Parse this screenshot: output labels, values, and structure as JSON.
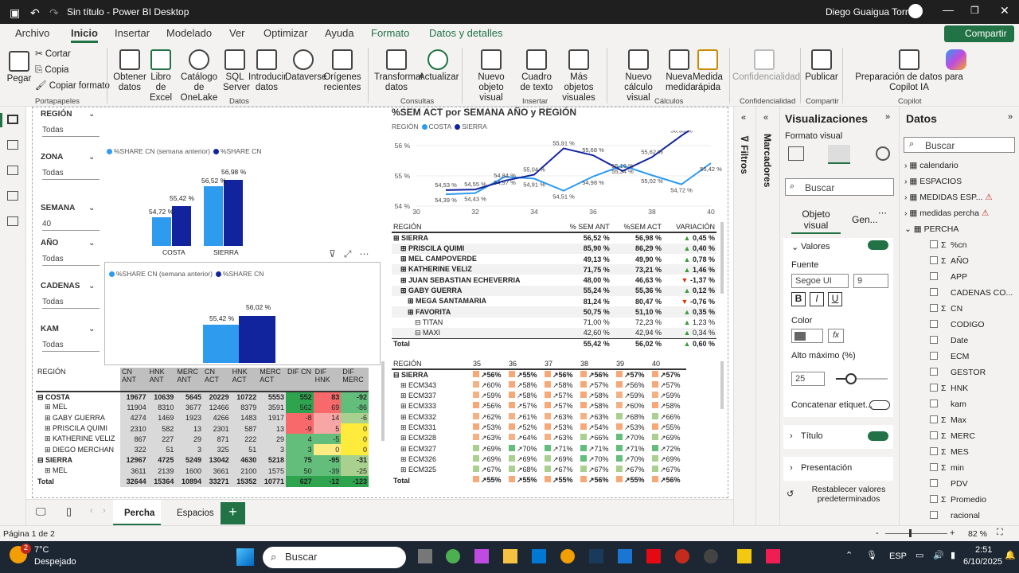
{
  "window": {
    "title": "Sin título - Power BI Desktop",
    "user": "Diego Guaigua Torres"
  },
  "menu": [
    "Archivo",
    "Inicio",
    "Insertar",
    "Modelado",
    "Ver",
    "Optimizar",
    "Ayuda",
    "Formato",
    "Datos y detalles"
  ],
  "share_button": "Compartir",
  "ribbon": {
    "buttons": [
      "Pegar",
      "Cortar",
      "Copia",
      "Copiar formato",
      "Obtener datos",
      "Libro de Excel",
      "Catálogo de OneLake",
      "SQL Server",
      "Introducir datos",
      "Dataverse",
      "Orígenes recientes",
      "Transformar datos",
      "Actualizar",
      "Nuevo objeto visual",
      "Cuadro de texto",
      "Más objetos visuales",
      "Nuevo cálculo visual",
      "Nueva medida",
      "Medida rápida",
      "Confidencialidad",
      "Publicar",
      "Preparación de datos para Copilot IA"
    ],
    "groups": [
      "Portapapeles",
      "Datos",
      "Consultas",
      "Insertar",
      "Cálculos",
      "Confidencialidad",
      "Compartir",
      "Copilot"
    ]
  },
  "slicers": [
    {
      "label": "REGIÓN",
      "value": "Todas"
    },
    {
      "label": "ZONA",
      "value": "Todas"
    },
    {
      "label": "SEMANA",
      "value": "40"
    },
    {
      "label": "AÑO",
      "value": "Todas"
    },
    {
      "label": "CADENAS",
      "value": "Todas"
    },
    {
      "label": "KAM",
      "value": "Todas"
    }
  ],
  "bar1": {
    "legend": [
      "%SHARE CN (semana anterior)",
      "%SHARE CN"
    ],
    "groups": [
      {
        "name": "COSTA",
        "values": [
          "54,72 %",
          "55,42 %"
        ]
      },
      {
        "name": "SIERRA",
        "values": [
          "56,52 %",
          "56,98 %"
        ]
      }
    ]
  },
  "bar2": {
    "legend": [
      "%SHARE CN (semana anterior)",
      "%SHARE CN"
    ],
    "values": [
      "55,42 %",
      "56,02 %"
    ]
  },
  "chart_data": {
    "type": "line",
    "title": "%SEM ACT por SEMANA AÑO y REGIÓN",
    "legend_title": "REGIÓN",
    "x": [
      30,
      31,
      32,
      33,
      34,
      35,
      36,
      37,
      38,
      39,
      40
    ],
    "x_ticks": [
      "30",
      "32",
      "34",
      "36",
      "38",
      "40"
    ],
    "y_ticks": [
      "54 %",
      "55 %",
      "56 %"
    ],
    "ylim": [
      54,
      56.5
    ],
    "series": [
      {
        "name": "COSTA",
        "color": "#2e9bef",
        "values": [
          54.39,
          54.43,
          54.97,
          54.91,
          54.51,
          54.98,
          55.34,
          55.02,
          54.72,
          55.42
        ]
      },
      {
        "name": "SIERRA",
        "color": "#12239e",
        "values": [
          54.53,
          54.55,
          54.84,
          55.04,
          55.91,
          55.68,
          55.16,
          55.62,
          56.33,
          56.98
        ]
      }
    ],
    "labels_costa": [
      "54,39 %",
      "54,43 %",
      "54,97 %",
      "54,91 %",
      "54,51 %",
      "54,98 %",
      "55,34 %",
      "55,02 %",
      "54,72 %",
      "55,42 %"
    ],
    "labels_sierra": [
      "54,53 %",
      "54,55 %",
      "54,84 %",
      "55,04 %",
      "55,91 %",
      "55,68 %",
      "55,16 %",
      "55,62 %",
      "56,33 %",
      "56,98 %"
    ]
  },
  "matrix1": {
    "headers": [
      "REGIÓN",
      "% SEM ANT",
      "%SEM ACT",
      "VARIACIÓN"
    ],
    "rows": [
      {
        "name": "SIERRA",
        "ant": "56,52 %",
        "act": "56,98 %",
        "var": "0,45 %",
        "up": true,
        "lvl": 0
      },
      {
        "name": "PRISCILA QUIMI",
        "ant": "85,90 %",
        "act": "86,29 %",
        "var": "0,40 %",
        "up": true,
        "lvl": 1
      },
      {
        "name": "MEL CAMPOVERDE",
        "ant": "49,13 %",
        "act": "49,90 %",
        "var": "0,78 %",
        "up": true,
        "lvl": 1
      },
      {
        "name": "KATHERINE VELIZ",
        "ant": "71,75 %",
        "act": "73,21 %",
        "var": "1,46 %",
        "up": true,
        "lvl": 1
      },
      {
        "name": "JUAN SEBASTIAN ECHEVERRIA",
        "ant": "48,00 %",
        "act": "46,63 %",
        "var": "-1,37 %",
        "up": false,
        "lvl": 1
      },
      {
        "name": "GABY GUERRA",
        "ant": "55,24 %",
        "act": "55,36 %",
        "var": "0,12 %",
        "up": true,
        "lvl": 1
      },
      {
        "name": "MEGA SANTAMARIA",
        "ant": "81,24 %",
        "act": "80,47 %",
        "var": "-0,76 %",
        "up": false,
        "lvl": 2
      },
      {
        "name": "FAVORITA",
        "ant": "50,75 %",
        "act": "51,10 %",
        "var": "0,35 %",
        "up": true,
        "lvl": 2
      },
      {
        "name": "TITAN",
        "ant": "71,00 %",
        "act": "72,23 %",
        "var": "1,23 %",
        "up": true,
        "lvl": 3
      },
      {
        "name": "MAXI",
        "ant": "42,60 %",
        "act": "42,94 %",
        "var": "0,34 %",
        "up": true,
        "lvl": 3
      }
    ],
    "total": {
      "name": "Total",
      "ant": "55,42 %",
      "act": "56,02 %",
      "var": "0,60 %"
    }
  },
  "matrix2": {
    "headers": [
      "REGIÓN",
      "CN ANT",
      "HNK ANT",
      "MERC ANT",
      "CN ACT",
      "HNK ACT",
      "MERC ACT",
      "DIF CN",
      "DIF HNK",
      "DIF MERC"
    ],
    "rows": [
      {
        "name": "COSTA",
        "lvl": 0,
        "v": [
          "19677",
          "10639",
          "5645",
          "20229",
          "10722",
          "5553",
          "552",
          "83",
          "-92"
        ]
      },
      {
        "name": "MEL",
        "lvl": 1,
        "v": [
          "11904",
          "8310",
          "3677",
          "12466",
          "8379",
          "3591",
          "562",
          "69",
          "-86"
        ]
      },
      {
        "name": "GABY GUERRA",
        "lvl": 1,
        "v": [
          "4274",
          "1469",
          "1923",
          "4266",
          "1483",
          "1917",
          "-8",
          "14",
          "-6"
        ]
      },
      {
        "name": "PRISCILA QUIMI",
        "lvl": 1,
        "v": [
          "2310",
          "582",
          "13",
          "2301",
          "587",
          "13",
          "-9",
          "5",
          "0"
        ]
      },
      {
        "name": "KATHERINE VELIZ",
        "lvl": 1,
        "v": [
          "867",
          "227",
          "29",
          "871",
          "222",
          "29",
          "4",
          "-5",
          "0"
        ]
      },
      {
        "name": "DIEGO MERCHAN",
        "lvl": 1,
        "v": [
          "322",
          "51",
          "3",
          "325",
          "51",
          "3",
          "3",
          "0",
          "0"
        ]
      },
      {
        "name": "SIERRA",
        "lvl": 0,
        "v": [
          "12967",
          "4725",
          "5249",
          "13042",
          "4630",
          "5218",
          "75",
          "-95",
          "-31"
        ]
      },
      {
        "name": "MEL",
        "lvl": 1,
        "v": [
          "3611",
          "2139",
          "1600",
          "3661",
          "2100",
          "1575",
          "50",
          "-39",
          "-25"
        ]
      }
    ],
    "total": {
      "name": "Total",
      "v": [
        "32644",
        "15364",
        "10894",
        "33271",
        "15352",
        "10771",
        "627",
        "-12",
        "-123"
      ]
    }
  },
  "matrix3": {
    "headers": [
      "REGIÓN",
      "35",
      "36",
      "37",
      "38",
      "39",
      "40"
    ],
    "rows": [
      {
        "name": "SIERRA",
        "v": [
          "56%",
          "55%",
          "56%",
          "56%",
          "57%",
          "57%"
        ]
      },
      {
        "name": "ECM343",
        "v": [
          "60%",
          "58%",
          "58%",
          "57%",
          "56%",
          "57%"
        ]
      },
      {
        "name": "ECM337",
        "v": [
          "59%",
          "58%",
          "57%",
          "58%",
          "59%",
          "59%"
        ]
      },
      {
        "name": "ECM333",
        "v": [
          "56%",
          "57%",
          "57%",
          "58%",
          "60%",
          "58%"
        ]
      },
      {
        "name": "ECM332",
        "v": [
          "62%",
          "61%",
          "63%",
          "63%",
          "68%",
          "66%"
        ]
      },
      {
        "name": "ECM331",
        "v": [
          "53%",
          "52%",
          "53%",
          "54%",
          "53%",
          "55%"
        ]
      },
      {
        "name": "ECM328",
        "v": [
          "63%",
          "64%",
          "63%",
          "66%",
          "70%",
          "69%"
        ]
      },
      {
        "name": "ECM327",
        "v": [
          "69%",
          "70%",
          "71%",
          "71%",
          "71%",
          "72%"
        ]
      },
      {
        "name": "ECM326",
        "v": [
          "69%",
          "69%",
          "69%",
          "70%",
          "70%",
          "69%"
        ]
      },
      {
        "name": "ECM325",
        "v": [
          "67%",
          "68%",
          "67%",
          "67%",
          "67%",
          "67%"
        ]
      }
    ],
    "total": {
      "name": "Total",
      "v": [
        "55%",
        "55%",
        "55%",
        "56%",
        "55%",
        "56%"
      ]
    }
  },
  "pages": [
    "Percha",
    "Espacios"
  ],
  "filters_label": "Filtros",
  "bookmarks_label": "Marcadores",
  "visualizations": {
    "title": "Visualizaciones",
    "subtitle": "Formato visual",
    "search": "Buscar",
    "tabs": [
      "Objeto visual",
      "Gen..."
    ],
    "valores": "Valores",
    "fuente": "Fuente",
    "font": "Segoe UI",
    "size": "9",
    "color": "Color",
    "alto": "Alto máximo (%)",
    "alto_val": "25",
    "concat": "Concatenar etiquet...",
    "titulo": "Título",
    "presentacion": "Presentación",
    "reset": "Restablecer valores predeterminados"
  },
  "data": {
    "title": "Datos",
    "search": "Buscar",
    "tables": [
      "calendario",
      "ESPACIOS",
      "MEDIDAS ESP...",
      "medidas percha",
      "PERCHA"
    ],
    "fields": [
      "%cn",
      "AÑO",
      "APP",
      "CADENAS CO...",
      "CN",
      "CODIGO",
      "Date",
      "ECM",
      "GESTOR",
      "HNK",
      "kam",
      "Max",
      "MERC",
      "MES",
      "min",
      "PDV",
      "Promedio",
      "racional"
    ],
    "sigma": [
      true,
      true,
      false,
      false,
      true,
      false,
      false,
      false,
      false,
      true,
      false,
      true,
      true,
      true,
      true,
      false,
      true,
      false
    ]
  },
  "status": {
    "page": "Página 1 de 2",
    "zoom": "82 %"
  },
  "taskbar": {
    "temp": "7°C",
    "weather": "Despejado",
    "search": "Buscar",
    "lang": "ESP",
    "time": "2:51",
    "date": "6/10/2025",
    "notif": "2"
  },
  "colors": {
    "costa": "#2e9bef",
    "sierra": "#12239e",
    "accent": "#217346"
  }
}
